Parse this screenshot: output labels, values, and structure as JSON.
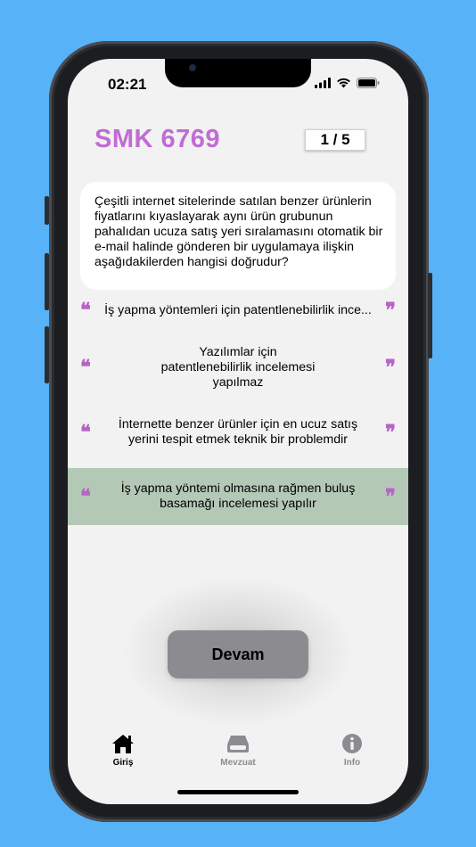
{
  "status_bar": {
    "time": "02:21"
  },
  "header": {
    "title": "SMK 6769",
    "counter": "1 / 5"
  },
  "question": "Çeşitli internet sitelerinde satılan benzer ürünlerin fiyatlarını kıyaslayarak aynı ürün grubunun pahalıdan ucuza satış yeri sıralamasını otomatik bir e-mail halinde gönderen bir uygulamaya ilişkin aşağıdakilerden hangisi doğrudur?",
  "options": [
    {
      "text": "İş yapma yöntemleri için patentlenebilirlik ince...",
      "selected": false
    },
    {
      "text": "Yazılımlar için patentlenebilirlik incelemesi yapılmaz",
      "selected": false
    },
    {
      "text": "İnternette benzer ürünler için en ucuz satış yerini tespit etmek teknik bir problemdir",
      "selected": false
    },
    {
      "text": "İş yapma yöntemi olmasına rağmen buluş basamağı incelemesi yapılır",
      "selected": true
    }
  ],
  "quote_open": "❝",
  "quote_close": "❞",
  "continue_label": "Devam",
  "tabs": [
    {
      "label": "Giriş",
      "icon": "home-icon",
      "active": true
    },
    {
      "label": "Mevzuat",
      "icon": "drive-icon",
      "active": false
    },
    {
      "label": "Info",
      "icon": "info-icon",
      "active": false
    }
  ],
  "colors": {
    "background": "#57b2f8",
    "accent": "#c06cd4",
    "selected_option": "#b4c8b6",
    "button": "#8c8c90"
  }
}
